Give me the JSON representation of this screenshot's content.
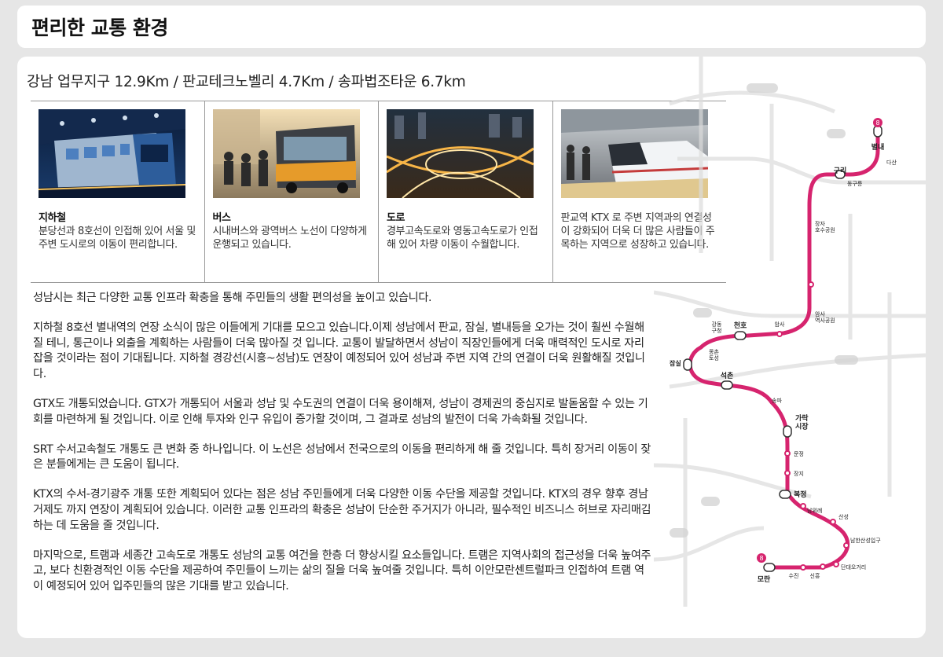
{
  "header": {
    "title": "편리한 교통 환경"
  },
  "distance_line": "강남 업무지구 12.9Km / 판교테크노벨리 4.7Km / 송파법조타운 6.7km",
  "cards": [
    {
      "title": "지하철",
      "desc": "분당선과 8호선이 인접해 있어 서울 및 주변 도시로의 이동이 편리합니다."
    },
    {
      "title": "버스",
      "desc": "시내버스와 광역버스 노선이 다양하게 운행되고 있습니다."
    },
    {
      "title": "도로",
      "desc": "경부고속도로와 영동고속도로가 인접해 있어 차량 이동이 수월합니다."
    },
    {
      "title": "",
      "desc": "판교역 KTX 로 주변 지역과의 연결성이 강화되어 더욱 더 많은 사람들이 주목하는 지역으로 성장하고 있습니다."
    }
  ],
  "paragraphs": [
    "성남시는 최근 다양한 교통 인프라 확충을 통해 주민들의 생활 편의성을 높이고 있습니다.",
    "지하철 8호선 별내역의 연장 소식이 많은 이들에게 기대를 모으고 있습니다.이제 성남에서 판교, 잠실, 별내등을 오가는 것이 훨씬 수월해질 테니, 통근이나 외출을 계획하는 사람들이 더욱 많아질 것 입니다. 교통이 발달하면서 성남이 직장인들에게 더욱 매력적인 도시로 자리 잡을 것이라는 점이 기대됩니다. 지하철 경강선(시흥~성남)도 연장이 예정되어 있어 성남과 주변 지역 간의 연결이 더욱 원활해질 것입니다.",
    "GTX도 개통되었습니다. GTX가 개통되어 서울과 성남 및 수도권의 연결이 더욱 용이해져, 성남이 경제권의 중심지로 발돋움할 수 있는 기회를 마련하게 될 것입니다. 이로 인해 투자와 인구 유입이 증가할 것이며, 그 결과로 성남의 발전이 더욱 가속화될 것입니다.",
    "SRT 수서고속철도 개통도 큰 변화 중 하나입니다. 이 노선은 성남에서 전국으로의 이동을 편리하게 해 줄 것입니다. 특히 장거리 이동이 잦은 분들에게는 큰 도움이 됩니다.",
    "KTX의 수서-경기광주 개통 또한 계획되어 있다는 점은 성남 주민들에게 더욱 다양한 이동 수단을 제공할 것입니다. KTX의 경우 향후 경남 거제도 까지 연장이 계획되어 있습니다. 이러한 교통 인프라의 확충은 성남이 단순한 주거지가 아니라, 필수적인 비즈니스 허브로 자리매김하는 데 도움을 줄 것입니다.",
    "마지막으로, 트램과 세종간 고속도로 개통도 성남의 교통 여건을 한층 더 향상시킬 요소들입니다. 트램은 지역사회의 접근성을 더욱 높여주고, 보다 친환경적인 이동 수단을 제공하여 주민들이 느끼는 삶의 질을 더욱 높여줄 것입니다. 특히 이안모란센트럴파크 인접하여 트램 역이 예정되어 있어 입주민들의 많은 기대를 받고 있습니다."
  ],
  "map": {
    "line_color": "#d6246e",
    "stations": {
      "byeollae": "별내",
      "dasan": "다산",
      "guri": "구리",
      "donggureung": "동구릉",
      "jangja": "장자\n호수공원",
      "amsa_park": "암사\n역사공원",
      "amsa": "암사",
      "cheonho": "천호",
      "gangdong": "강동\n구청",
      "mongchon": "몽촌\n토성",
      "jamsil": "잠실",
      "seokchon": "석촌",
      "songpa": "송파",
      "garak": "가락\n시장",
      "munjeong": "문정",
      "jangji": "장지",
      "bokjeong": "복정",
      "namwirye": "남위례",
      "sanseong": "산성",
      "namhansanseong": "남한산성입구",
      "dandae": "단대오거리",
      "sinheung": "신흥",
      "suin": "수진",
      "moran": "모란",
      "term_badge": "8"
    }
  }
}
